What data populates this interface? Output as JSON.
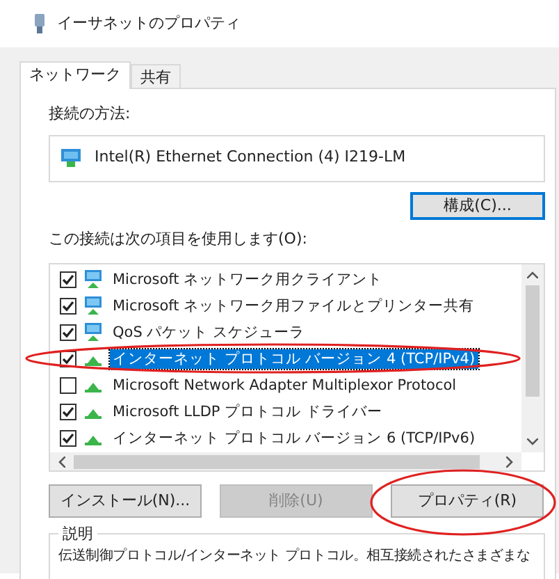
{
  "window": {
    "title": "イーサネットのプロパティ"
  },
  "tabs": [
    {
      "label": "ネットワーク",
      "selected": true
    },
    {
      "label": "共有",
      "selected": false
    }
  ],
  "connect_using": {
    "label": "接続の方法:",
    "adapter": "Intel(R) Ethernet Connection (4) I219-LM"
  },
  "configure_button": {
    "label": "構成(C)...",
    "focused": true
  },
  "items_label": "この接続は次の項目を使用します(O):",
  "items": [
    {
      "label": "Microsoft ネットワーク用クライアント",
      "kind": "client",
      "checked": true,
      "selected": false,
      "highlighted": false
    },
    {
      "label": "Microsoft ネットワーク用ファイルとプリンター共有",
      "kind": "client",
      "checked": true,
      "selected": false,
      "highlighted": false
    },
    {
      "label": "QoS パケット スケジューラ",
      "kind": "client",
      "checked": true,
      "selected": false,
      "highlighted": false
    },
    {
      "label": "インターネット プロトコル バージョン 4 (TCP/IPv4)",
      "kind": "protocol",
      "checked": true,
      "selected": true,
      "highlighted": true
    },
    {
      "label": "Microsoft Network Adapter Multiplexor Protocol",
      "kind": "protocol",
      "checked": false,
      "selected": false,
      "highlighted": false
    },
    {
      "label": "Microsoft LLDP プロトコル ドライバー",
      "kind": "protocol",
      "checked": true,
      "selected": false,
      "highlighted": false
    },
    {
      "label": "インターネット プロトコル バージョン 6 (TCP/IPv6)",
      "kind": "protocol",
      "checked": true,
      "selected": false,
      "highlighted": false
    }
  ],
  "buttons": [
    {
      "label": "インストール(N)...",
      "disabled": false,
      "highlighted": false
    },
    {
      "label": "削除(U)",
      "disabled": true,
      "highlighted": false
    },
    {
      "label": "プロパティ(R)",
      "disabled": false,
      "highlighted": true
    }
  ],
  "description": {
    "title": "説明",
    "text": "伝送制御プロトコル/インターネット プロトコル。相互接続されたさまざまな"
  }
}
